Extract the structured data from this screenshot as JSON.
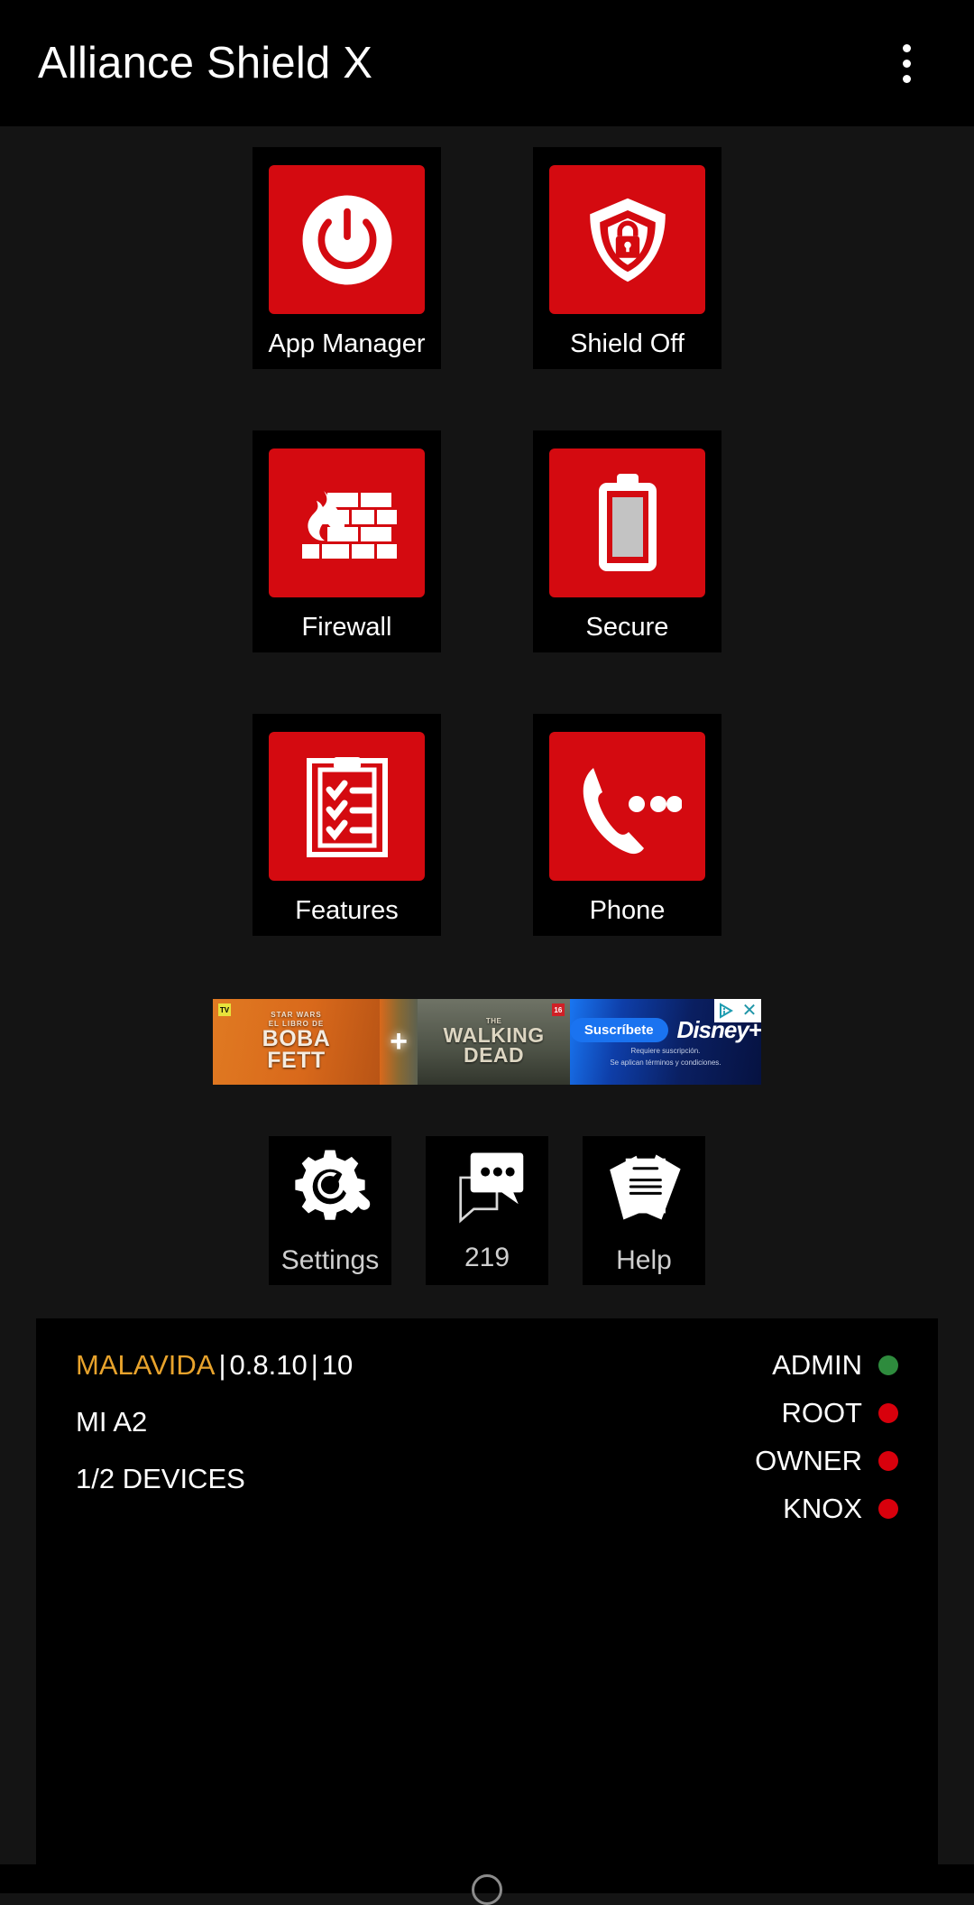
{
  "appbar": {
    "title": "Alliance Shield X",
    "overflow_icon": "more-vertical-icon"
  },
  "grid": {
    "tiles": [
      {
        "label": "App Manager",
        "icon": "power-icon"
      },
      {
        "label": "Shield Off",
        "icon": "shield-lock-icon"
      },
      {
        "label": "Firewall",
        "icon": "firewall-brick-flame-icon"
      },
      {
        "label": "Secure",
        "icon": "battery-icon"
      },
      {
        "label": "Features",
        "icon": "clipboard-checklist-icon"
      },
      {
        "label": "Phone",
        "icon": "phone-dots-icon"
      }
    ],
    "tile_color": "#d40a10"
  },
  "ad": {
    "boba_pre": "STAR WARS",
    "boba_pre2": "EL LIBRO DE",
    "boba_title_1": "BOBA",
    "boba_title_2": "FETT",
    "boba_badge": "TV",
    "plus": "+",
    "twd_pre": "THE",
    "twd_title_1": "WALKING",
    "twd_title_2": "DEAD",
    "twd_badge": "16",
    "cta": "Suscríbete",
    "brand": "Disney+",
    "fine_1": "Requiere suscripción.",
    "fine_2": "Se aplican términos y condiciones.",
    "adchoices_icon": "adchoices-icon",
    "close_icon": "close-icon",
    "close_glyph": "✕"
  },
  "actions": [
    {
      "label": "Settings",
      "icon": "gear-wrench-icon"
    },
    {
      "label": "219",
      "icon": "chat-bubbles-icon"
    },
    {
      "label": "Help",
      "icon": "documents-stack-icon"
    }
  ],
  "status": {
    "brand": "MALAVIDA",
    "version": "0.8.10",
    "build": "10",
    "separator": "|",
    "device": "MI A2",
    "devices": "1/2 DEVICES",
    "indicators": [
      {
        "label": "ADMIN",
        "color": "#2e8b3d"
      },
      {
        "label": "ROOT",
        "color": "#d8000c"
      },
      {
        "label": "OWNER",
        "color": "#d8000c"
      },
      {
        "label": "KNOX",
        "color": "#d8000c"
      }
    ]
  },
  "navbar": {
    "home_icon": "home-circle-icon"
  }
}
